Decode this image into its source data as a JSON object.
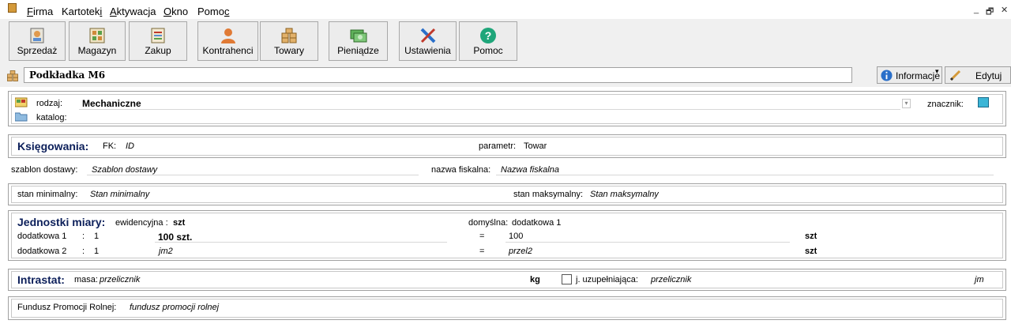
{
  "menu": {
    "items": [
      "Firma",
      "Kartoteki",
      "Aktywacja",
      "Okno",
      "Pomoc"
    ],
    "window_controls": [
      "_",
      "🗗",
      "✕"
    ]
  },
  "toolbar": {
    "buttons": [
      "Sprzedaż",
      "Magazyn",
      "Zakup",
      "Kontrahenci",
      "Towary",
      "Pieniądze",
      "Ustawienia",
      "Pomoc"
    ]
  },
  "title": "Podkładka M6",
  "buttons": {
    "info": "Informacje",
    "edit": "Edytuj"
  },
  "rodzaj": {
    "label": "rodzaj:",
    "value": "Mechaniczne",
    "catalog_label": "katalog:",
    "marker_label": "znacznik:"
  },
  "ksiegowania": {
    "title": "Księgowania:",
    "fk_label": "FK:",
    "fk_value": "ID",
    "param_label": "parametr:",
    "param_value": "Towar"
  },
  "szablon": {
    "label": "szablon dostawy:",
    "value": "Szablon dostawy",
    "fiskal_label": "nazwa fiskalna:",
    "fiskal_value": "Nazwa fiskalna"
  },
  "stan": {
    "min_label": "stan minimalny:",
    "min_value": "Stan minimalny",
    "max_label": "stan maksymalny:",
    "max_value": "Stan maksymalny"
  },
  "jednostki": {
    "title": "Jednostki miary:",
    "ewid_label": "ewidencyjna :",
    "ewid_value": "szt",
    "dom_label": "domyślna:",
    "dom_value": "dodatkowa 1",
    "rows": [
      {
        "label": "dodatkowa 1",
        "colon": ":",
        "qty": "1",
        "unit": "100 szt.",
        "eq": "=",
        "value": "100",
        "base": "szt"
      },
      {
        "label": "dodatkowa 2",
        "colon": ":",
        "qty": "1",
        "unit": "jm2",
        "eq": "=",
        "value": "przel2",
        "base": "szt"
      }
    ]
  },
  "intrastat": {
    "title": "Intrastat:",
    "masa_label": "masa:",
    "masa_value": "przelicznik",
    "kg": "kg",
    "uzup_label": "j. uzupełniająca:",
    "uzup_value": "przelicznik",
    "jm": "jm"
  },
  "fundusz": {
    "label": "Fundusz Promocji Rolnej:",
    "value": "fundusz promocji rolnej"
  },
  "colors": {
    "accent": "#0c1f5a"
  }
}
